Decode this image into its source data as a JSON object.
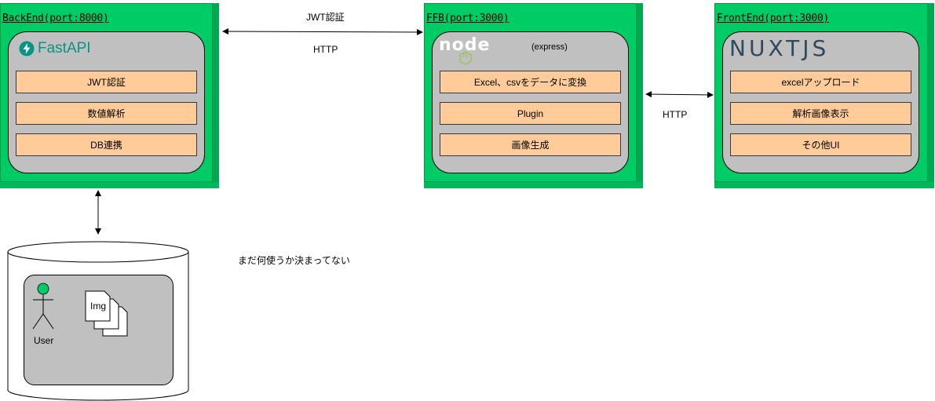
{
  "nodes": {
    "backend": {
      "title": "BackEnd(port:8000)",
      "logo_text": "FastAPI",
      "items": [
        "JWT認証",
        "数値解析",
        "DB連携"
      ]
    },
    "ffb": {
      "title": "FFB(port:3000)",
      "logo_text": "node",
      "logo_badge": "JS",
      "subtitle": "(express)",
      "items": [
        "Excel、csvをデータに変換",
        "Plugin",
        "画像生成"
      ]
    },
    "frontend": {
      "title": "FrontEnd(port:3000)",
      "logo_text": "NUXTJS",
      "items": [
        "excelアップロード",
        "解析画像表示",
        "その他UI"
      ]
    }
  },
  "connections": {
    "backend_ffb_top_label": "JWT認証",
    "backend_ffb_bottom_label": "HTTP",
    "ffb_frontend_label": "HTTP"
  },
  "database": {
    "user_label": "User",
    "img_label": "Img",
    "note": "まだ何使うか決まってない"
  },
  "colors": {
    "node_green": "#00cc66",
    "inner_gray": "#c0c0c0",
    "item_orange": "#ffcc99",
    "fastapi_teal": "#059486",
    "nuxt_dark": "#2f495e",
    "nuxt_green": "#00c58e"
  }
}
